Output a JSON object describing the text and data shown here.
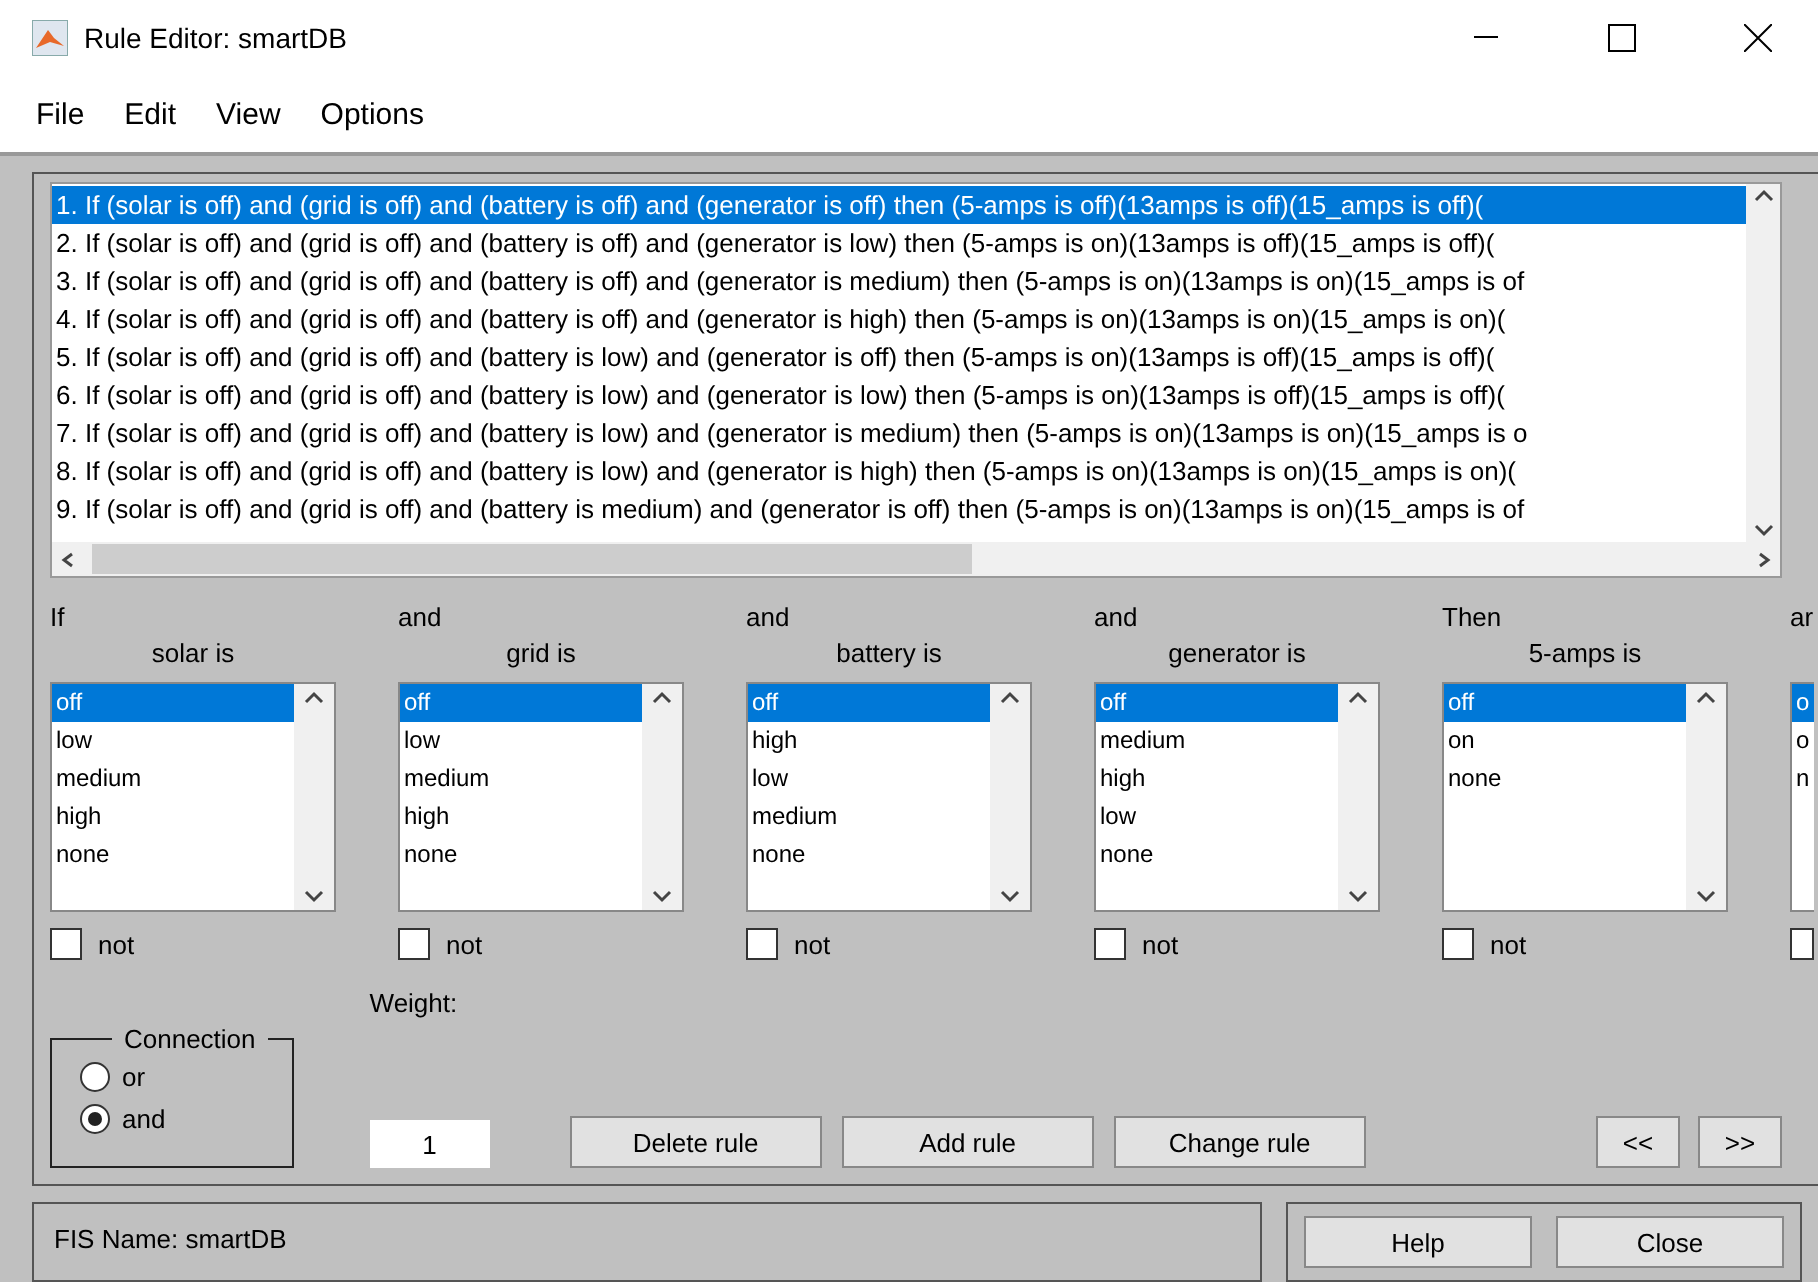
{
  "window": {
    "title": "Rule Editor: smartDB"
  },
  "menu": [
    "File",
    "Edit",
    "View",
    "Options"
  ],
  "rules": [
    {
      "text": "1. If (solar is off) and (grid is off) and (battery is off) and (generator is off) then (5-amps is off)(13amps is off)(15_amps is off)(",
      "selected": true
    },
    {
      "text": "2. If (solar is off) and (grid is off) and (battery is off) and (generator is low) then (5-amps is on)(13amps is off)(15_amps is off)(",
      "selected": false
    },
    {
      "text": "3. If (solar is off) and (grid is off) and (battery is off) and (generator is medium) then (5-amps is on)(13amps is on)(15_amps is of",
      "selected": false
    },
    {
      "text": "4. If (solar is off) and (grid is off) and (battery is off) and (generator is high) then (5-amps is on)(13amps is on)(15_amps is on)(",
      "selected": false
    },
    {
      "text": "5. If (solar is off) and (grid is off) and (battery is low) and (generator is off) then (5-amps is on)(13amps is off)(15_amps is off)(",
      "selected": false
    },
    {
      "text": "6. If (solar is off) and (grid is off) and (battery is low) and (generator is low) then (5-amps is on)(13amps is off)(15_amps is off)(",
      "selected": false
    },
    {
      "text": "7. If (solar is off) and (grid is off) and (battery is low) and (generator is medium) then (5-amps is on)(13amps is on)(15_amps is o",
      "selected": false
    },
    {
      "text": "8. If (solar is off) and (grid is off) and (battery is low) and (generator is high) then (5-amps is on)(13amps is on)(15_amps is on)(",
      "selected": false
    },
    {
      "text": "9. If (solar is off) and (grid is off) and (battery is medium) and (generator is off) then (5-amps is on)(13amps is on)(15_amps is of",
      "selected": false
    }
  ],
  "columns": [
    {
      "kind": "full",
      "heading": "If",
      "variable": "solar is",
      "not": false,
      "not_label": "not",
      "options": [
        {
          "label": "off",
          "selected": true
        },
        {
          "label": "low",
          "selected": false
        },
        {
          "label": "medium",
          "selected": false
        },
        {
          "label": "high",
          "selected": false
        },
        {
          "label": "none",
          "selected": false
        }
      ]
    },
    {
      "kind": "full",
      "heading": "and",
      "variable": "grid is",
      "not": false,
      "not_label": "not",
      "options": [
        {
          "label": "off",
          "selected": true
        },
        {
          "label": "low",
          "selected": false
        },
        {
          "label": "medium",
          "selected": false
        },
        {
          "label": "high",
          "selected": false
        },
        {
          "label": "none",
          "selected": false
        }
      ]
    },
    {
      "kind": "full",
      "heading": "and",
      "variable": "battery is",
      "not": false,
      "not_label": "not",
      "options": [
        {
          "label": "off",
          "selected": true
        },
        {
          "label": "high",
          "selected": false
        },
        {
          "label": "low",
          "selected": false
        },
        {
          "label": "medium",
          "selected": false
        },
        {
          "label": "none",
          "selected": false
        }
      ]
    },
    {
      "kind": "full",
      "heading": "and",
      "variable": "generator is",
      "not": false,
      "not_label": "not",
      "options": [
        {
          "label": "off",
          "selected": true
        },
        {
          "label": "medium",
          "selected": false
        },
        {
          "label": "high",
          "selected": false
        },
        {
          "label": "low",
          "selected": false
        },
        {
          "label": "none",
          "selected": false
        }
      ]
    },
    {
      "kind": "full",
      "heading": "Then",
      "variable": "5-amps is",
      "not": false,
      "not_label": "not",
      "options": [
        {
          "label": "off",
          "selected": true
        },
        {
          "label": "on",
          "selected": false
        },
        {
          "label": "none",
          "selected": false
        }
      ]
    },
    {
      "kind": "partial",
      "heading": "ar",
      "not": false,
      "options": [
        {
          "label": "o",
          "selected": true
        },
        {
          "label": "o",
          "selected": false
        },
        {
          "label": "n",
          "selected": false
        }
      ]
    }
  ],
  "connection": {
    "title": "Connection",
    "options": [
      {
        "label": "or",
        "selected": false
      },
      {
        "label": "and",
        "selected": true
      }
    ]
  },
  "weight": {
    "label": "Weight:",
    "value": "1"
  },
  "actions": [
    "Delete rule",
    "Add rule",
    "Change rule"
  ],
  "nav": [
    "<<",
    ">>"
  ],
  "status": "FIS Name: smartDB",
  "footer_buttons": [
    "Help",
    "Close"
  ]
}
